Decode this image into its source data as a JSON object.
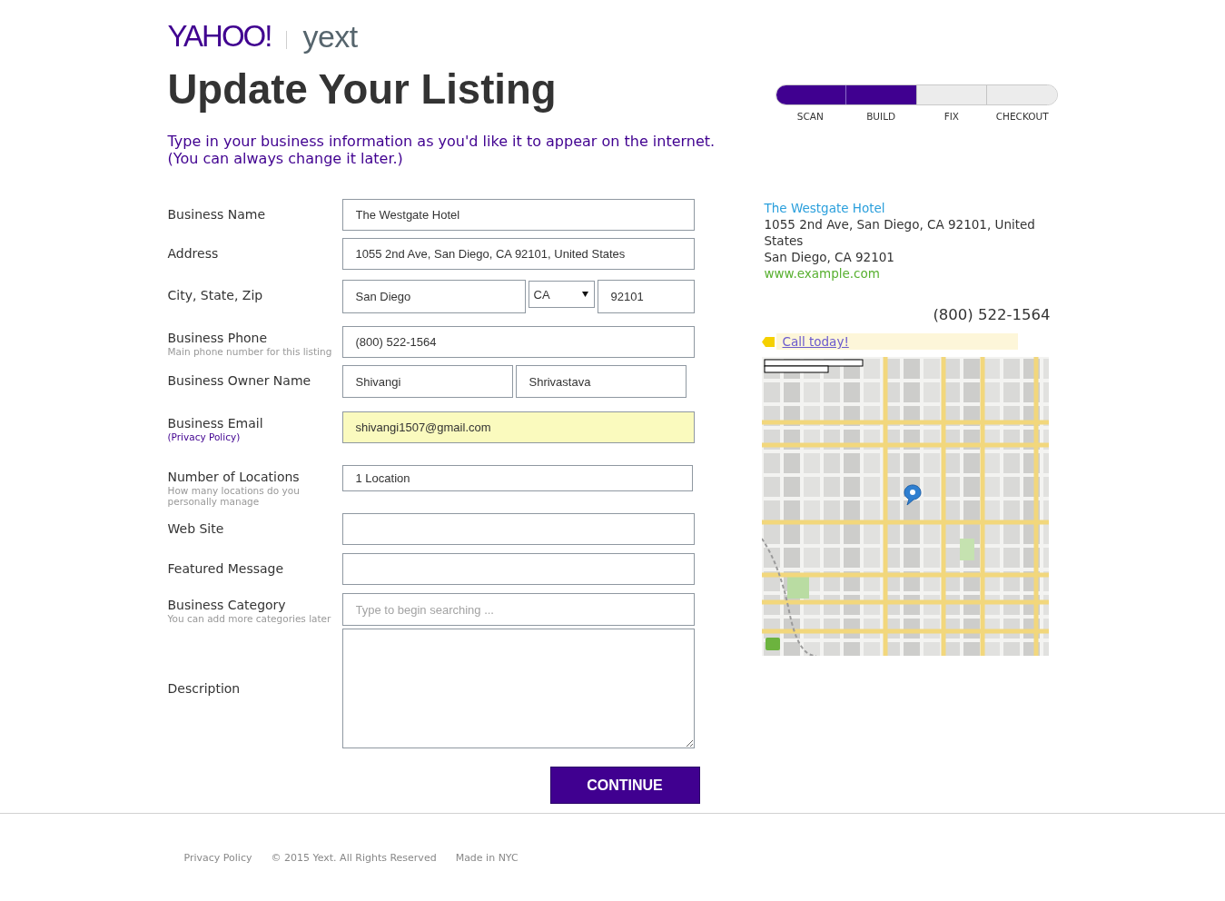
{
  "header": {
    "logos": [
      {
        "kind": "yahoo",
        "text": "YAHOO!"
      },
      {
        "kind": "yext",
        "text": "yext"
      }
    ]
  },
  "title": "Update Your Listing",
  "intro": [
    "Type in your business information as you'd like it to appear on the internet.",
    "(You can always change it later.)"
  ],
  "progress": {
    "steps": [
      {
        "label": "SCAN",
        "completed": true
      },
      {
        "label": "BUILD",
        "completed": true
      },
      {
        "label": "FIX",
        "completed": false
      },
      {
        "label": "CHECKOUT",
        "completed": false
      }
    ]
  },
  "form": {
    "rows": [
      {
        "label": "Business Name",
        "fields": [
          {
            "kind": "text",
            "value": "The Westgate Hotel",
            "autofilled": false
          }
        ]
      },
      {
        "label": "Address",
        "fields": [
          {
            "kind": "text",
            "value": "1055 2nd Ave, San Diego, CA 92101, United States",
            "autofilled": false
          }
        ]
      },
      {
        "label": "City, State, Zip",
        "fields": [
          {
            "kind": "city",
            "value": "San Diego",
            "autofilled": false
          },
          {
            "kind": "state",
            "value": "CA",
            "autofilled": false
          },
          {
            "kind": "zip",
            "value": "92101",
            "autofilled": false
          }
        ]
      },
      {
        "label": "Business Phone",
        "hint": {
          "kind": "note",
          "text": "Main phone number for this listing"
        },
        "fields": [
          {
            "kind": "text",
            "value": "(800) 522-1564",
            "autofilled": false
          }
        ]
      },
      {
        "label": "Business Owner Name",
        "fields": [
          {
            "kind": "half",
            "value": "Shivangi",
            "autofilled": false
          },
          {
            "kind": "half",
            "value": "Shrivastava",
            "autofilled": false
          }
        ]
      },
      {
        "label": "Business Email",
        "hint": {
          "kind": "link",
          "text": "(Privacy Policy)"
        },
        "fields": [
          {
            "kind": "text",
            "value": "shivangi1507@gmail.com",
            "autofilled": true
          }
        ]
      },
      {
        "label": "Number of Locations",
        "hint": {
          "kind": "note",
          "text": "How many locations do you personally manage"
        },
        "fields": [
          {
            "kind": "select",
            "value": "1 Location",
            "autofilled": false
          }
        ]
      },
      {
        "label": "Web Site",
        "fields": [
          {
            "kind": "text",
            "autofilled": false
          }
        ]
      },
      {
        "label": "Featured Message",
        "fields": [
          {
            "kind": "text",
            "autofilled": false
          }
        ]
      },
      {
        "label": "Business Category",
        "hint": {
          "kind": "note",
          "text": "You can add more categories later"
        },
        "fields": [
          {
            "kind": "search",
            "placeholder": "Type to begin searching ...",
            "autofilled": false
          }
        ]
      },
      {
        "label": "Description",
        "fields": [
          {
            "kind": "textarea",
            "autofilled": false
          }
        ]
      }
    ],
    "submit": "CONTINUE"
  },
  "preview": {
    "name": "The Westgate Hotel",
    "address": "1055 2nd Ave, San Diego, CA 92101, United States",
    "city_line": "San Diego, CA 92101",
    "website": "www.example.com",
    "phone": "(800) 522-1564",
    "call_link": "Call today!"
  },
  "footer": {
    "privacy_link": "Privacy Policy",
    "copyright": "© 2015 Yext. All Rights Reserved",
    "made_in_link": "Made in NYC"
  }
}
